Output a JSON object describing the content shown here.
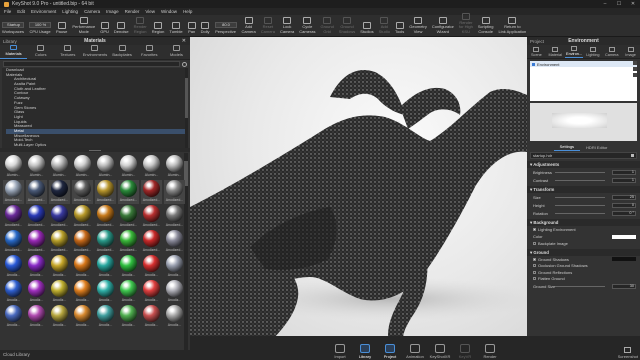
{
  "window": {
    "title": "KeyShot 9.0 Pro - untitled.bip - 64 bit",
    "minimize": "–",
    "maximize": "☐",
    "close": "✕"
  },
  "menu": [
    "File",
    "Edit",
    "Environment",
    "Lighting",
    "Camera",
    "Image",
    "Render",
    "View",
    "Window",
    "Help"
  ],
  "ribbon": {
    "workspace_field": "Startup",
    "cpu_field": "100 %",
    "zoom_field": "80.0",
    "buttons": [
      {
        "label": "Workspaces",
        "dim": false
      },
      {
        "label": "CPU Usage",
        "dim": false
      },
      {
        "label": "Pause",
        "dim": false
      },
      {
        "label": "Performance\nMode",
        "dim": false
      },
      {
        "label": "GPU",
        "dim": false
      },
      {
        "label": "Denoise",
        "dim": false
      },
      {
        "label": "Render\nRegion",
        "dim": true
      },
      {
        "label": "Region",
        "dim": false
      },
      {
        "label": "Tumble",
        "dim": false
      },
      {
        "label": "Pan",
        "dim": false
      },
      {
        "label": "Dolly",
        "dim": false
      },
      {
        "label": "Perspective",
        "dim": false
      },
      {
        "label": "Add\nCamera",
        "dim": false
      },
      {
        "label": "Reset\nCamera",
        "dim": true
      },
      {
        "label": "Lock\nCamera",
        "dim": false
      },
      {
        "label": "Cycle\nCameras",
        "dim": false
      },
      {
        "label": "Ground\nGrid",
        "dim": true
      },
      {
        "label": "Ground\nShadows",
        "dim": true
      },
      {
        "label": "Studios",
        "dim": false
      },
      {
        "label": "Add\nStudio",
        "dim": true
      },
      {
        "label": "Tools",
        "dim": false
      },
      {
        "label": "Geometry\nView",
        "dim": false
      },
      {
        "label": "Configurator\nWizard",
        "dim": false
      },
      {
        "label": "Render\nfor High\nKSU",
        "dim": true
      },
      {
        "label": "Scripting\nConsole",
        "dim": false
      },
      {
        "label": "Return to\nLink Application",
        "dim": false
      }
    ]
  },
  "library": {
    "title": "Library",
    "panel_title": "Materials",
    "tabs": [
      "Materials",
      "Colors",
      "Textures",
      "Environments",
      "Backplates",
      "Favorites",
      "Models"
    ],
    "active_tab": "Materials",
    "tree": [
      {
        "label": "Download",
        "level": 1,
        "selected": false
      },
      {
        "label": "Materials",
        "level": 1,
        "selected": false
      },
      {
        "label": "Architectural",
        "level": 2,
        "selected": false
      },
      {
        "label": "Axalta Paint",
        "level": 2,
        "selected": false
      },
      {
        "label": "Cloth and Leather",
        "level": 2,
        "selected": false
      },
      {
        "label": "Contour",
        "level": 2,
        "selected": false
      },
      {
        "label": "Cutaway",
        "level": 2,
        "selected": false
      },
      {
        "label": "Fuzz",
        "level": 2,
        "selected": false
      },
      {
        "label": "Gem Stones",
        "level": 2,
        "selected": false
      },
      {
        "label": "Glass",
        "level": 2,
        "selected": false
      },
      {
        "label": "Light",
        "level": 2,
        "selected": false
      },
      {
        "label": "Liquids",
        "level": 2,
        "selected": false
      },
      {
        "label": "Measured",
        "level": 2,
        "selected": false
      },
      {
        "label": "Metal",
        "level": 2,
        "selected": true
      },
      {
        "label": "Miscellaneous",
        "level": 2,
        "selected": false
      },
      {
        "label": "Mold-Tech",
        "level": 2,
        "selected": false
      },
      {
        "label": "Multi-Layer Optics",
        "level": 2,
        "selected": false
      }
    ],
    "thumbnails": [
      {
        "label": "Alumin...",
        "color": "#d8d8d8"
      },
      {
        "label": "Alumin...",
        "color": "#c4c4c4"
      },
      {
        "label": "Alumin...",
        "color": "#b8b8b8"
      },
      {
        "label": "Alumin...",
        "color": "#cfcfcf"
      },
      {
        "label": "Alumin...",
        "color": "#bdbdbd"
      },
      {
        "label": "Alumin...",
        "color": "#d0d0d0"
      },
      {
        "label": "Alumin...",
        "color": "#c8c8c8"
      },
      {
        "label": "Alumin...",
        "color": "#bebebe"
      },
      {
        "label": "Anodized...",
        "color": "#9aa6b8"
      },
      {
        "label": "Anodized...",
        "color": "#4a5a78"
      },
      {
        "label": "Anodized...",
        "color": "#1f2740"
      },
      {
        "label": "Anodized...",
        "color": "#606060"
      },
      {
        "label": "Anodized...",
        "color": "#b8962c"
      },
      {
        "label": "Anodized...",
        "color": "#2a8a3a"
      },
      {
        "label": "Anodized...",
        "color": "#a02828"
      },
      {
        "label": "Anodized...",
        "color": "#8a8a8a"
      },
      {
        "label": "Anodized...",
        "color": "#6a2a9a"
      },
      {
        "label": "Anodized...",
        "color": "#2a3ab8"
      },
      {
        "label": "Anodized...",
        "color": "#3a3aa0"
      },
      {
        "label": "Anodized...",
        "color": "#b89a2a"
      },
      {
        "label": "Anodized...",
        "color": "#c87a1a"
      },
      {
        "label": "Anodized...",
        "color": "#3a7a3a"
      },
      {
        "label": "Anodized...",
        "color": "#b83030"
      },
      {
        "label": "Anodized...",
        "color": "#7a7a7a"
      },
      {
        "label": "Anodized...",
        "color": "#2a6ac8"
      },
      {
        "label": "Anodized...",
        "color": "#9a2ab8"
      },
      {
        "label": "Anodized...",
        "color": "#b8a02a"
      },
      {
        "label": "Anodized...",
        "color": "#c86a1a"
      },
      {
        "label": "Anodized...",
        "color": "#2a9a8a"
      },
      {
        "label": "Anodized...",
        "color": "#3ab83a"
      },
      {
        "label": "Anodized...",
        "color": "#c82a2a"
      },
      {
        "label": "Anodized...",
        "color": "#8a8a9a"
      },
      {
        "label": "Anodiz...",
        "color": "#2a5ad8"
      },
      {
        "label": "Anodiz...",
        "color": "#8a2ac8"
      },
      {
        "label": "Anodiz...",
        "color": "#c8a82a"
      },
      {
        "label": "Anodiz...",
        "color": "#d8781a"
      },
      {
        "label": "Anodiz...",
        "color": "#28a8a0"
      },
      {
        "label": "Anodiz...",
        "color": "#30c040"
      },
      {
        "label": "Anodiz...",
        "color": "#d83030"
      },
      {
        "label": "Anodiz...",
        "color": "#9aa0b0"
      },
      {
        "label": "Anodiz...",
        "color": "#3060d0"
      },
      {
        "label": "Anodiz...",
        "color": "#a030c0"
      },
      {
        "label": "Anodiz...",
        "color": "#c0b030"
      },
      {
        "label": "Anodiz...",
        "color": "#e08020"
      },
      {
        "label": "Anodiz...",
        "color": "#30b0a8"
      },
      {
        "label": "Anodiz...",
        "color": "#40c850"
      },
      {
        "label": "Anodiz...",
        "color": "#e04040"
      },
      {
        "label": "Anodiz...",
        "color": "#b0b0b8"
      },
      {
        "label": "Anodiz...",
        "color": "#4a6ac0"
      },
      {
        "label": "Anodiz...",
        "color": "#b04ab0"
      },
      {
        "label": "Anodiz...",
        "color": "#b8a840"
      },
      {
        "label": "Anodiz...",
        "color": "#d88a30"
      },
      {
        "label": "Anodiz...",
        "color": "#40a0a0"
      },
      {
        "label": "Anodiz...",
        "color": "#50b050"
      },
      {
        "label": "Anodiz...",
        "color": "#c85050"
      },
      {
        "label": "Anodiz...",
        "color": "#a8a8a8"
      }
    ],
    "cloud_label": "Cloud Library"
  },
  "project": {
    "title": "Project",
    "panel_title": "Environment",
    "tabs": [
      "Scene",
      "Material",
      "Environ...",
      "Lighting",
      "Camera",
      "Image"
    ],
    "active_tab": "Environ...",
    "env_item": "Environment",
    "settings_tabs": [
      "Settings",
      "HDRI Editor"
    ],
    "active_settings_tab": "Settings",
    "hdri_file": "startup.hdr",
    "adjustments": {
      "header": "Adjustments",
      "brightness_label": "Brightness",
      "brightness": "1",
      "contrast_label": "Contrast",
      "contrast": "1"
    },
    "transform": {
      "header": "Transform",
      "size_label": "Size",
      "size": "25",
      "height_label": "Height",
      "height": "0",
      "rotation_label": "Rotation",
      "rotation": "0 °"
    },
    "background": {
      "header": "Background",
      "lighting_env": "Lighting Environment",
      "color_label": "Color",
      "backplate": "Backplate Image"
    },
    "ground": {
      "header": "Ground",
      "ground_shadows": "Ground Shadows",
      "occlusion": "Occlusion Ground Shadows",
      "reflections": "Ground Reflections",
      "flatten": "Flatten Ground",
      "size_label": "Ground Size",
      "size": "30"
    }
  },
  "dock": [
    {
      "label": "Import",
      "active": false,
      "dim": false
    },
    {
      "label": "Library",
      "active": true,
      "dim": false
    },
    {
      "label": "Project",
      "active": true,
      "dim": false
    },
    {
      "label": "Animation",
      "active": false,
      "dim": false
    },
    {
      "label": "KeyShotXR",
      "active": false,
      "dim": false
    },
    {
      "label": "KeyVR",
      "active": false,
      "dim": true
    },
    {
      "label": "Render",
      "active": false,
      "dim": false
    }
  ],
  "screenshot_label": "Screenshot"
}
